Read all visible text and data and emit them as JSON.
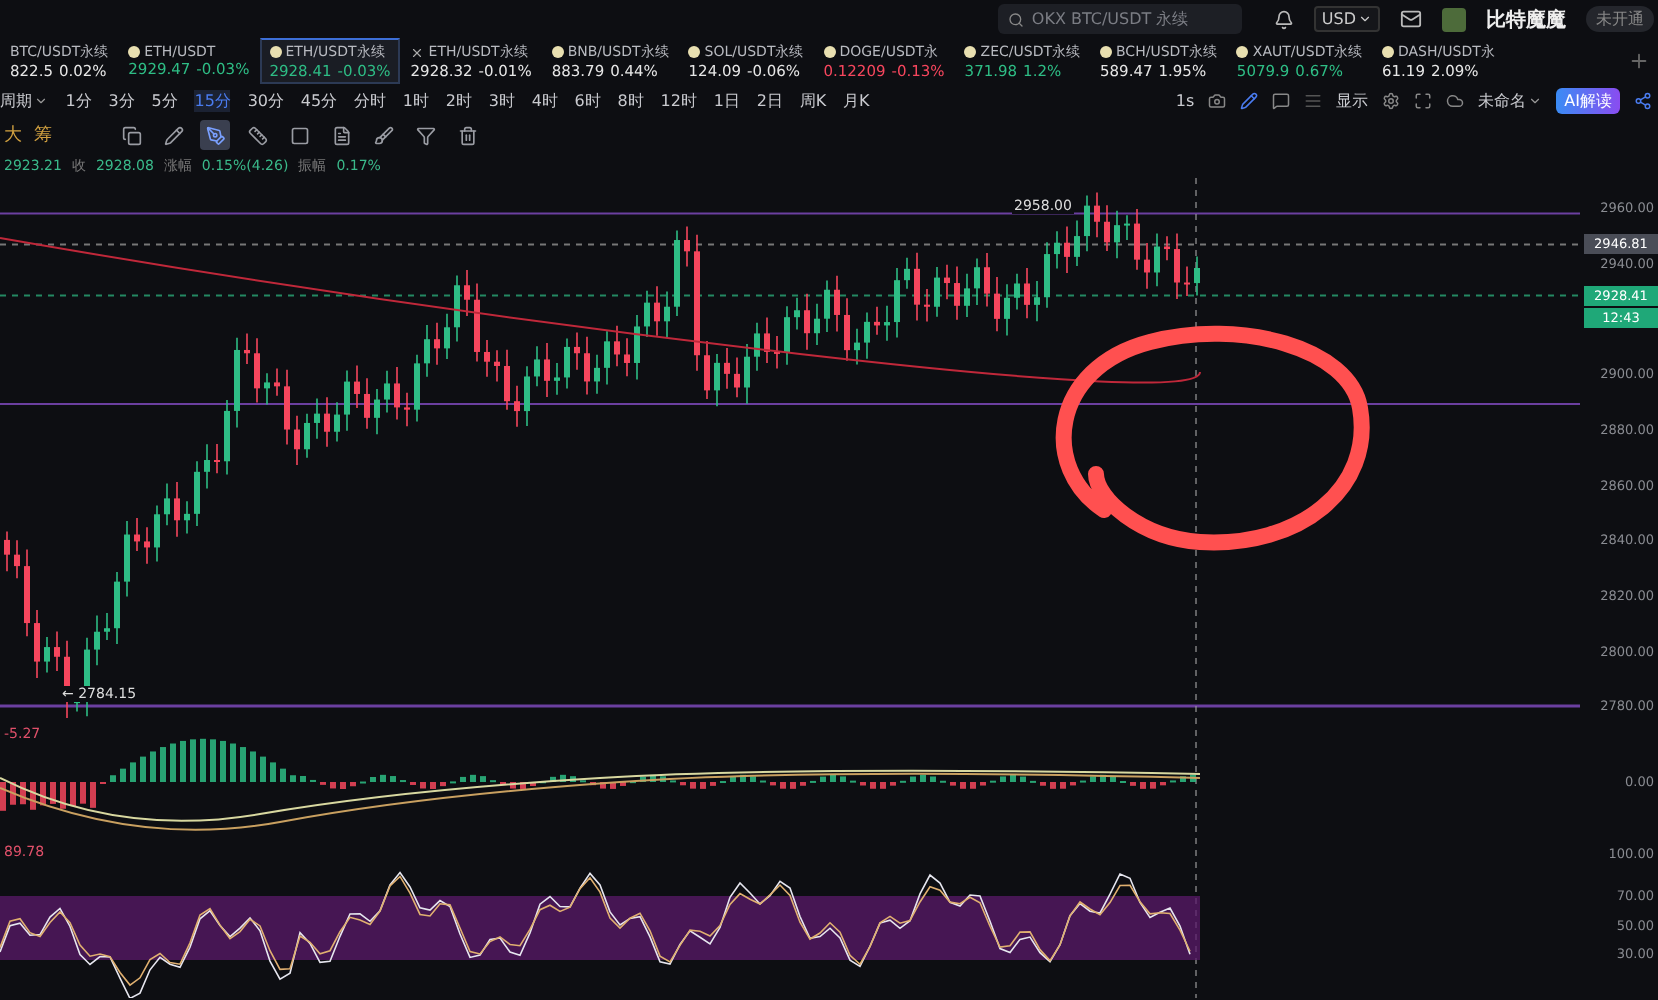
{
  "top_bar": {
    "search": {
      "placeholder": "OKX BTC/USDT 永续"
    },
    "currency": "USD",
    "user": {
      "name": "比特魔魔",
      "badge": "未开通"
    }
  },
  "tickers": [
    {
      "name": "BTC/USDT永续",
      "price": "822.5",
      "change": "0.02%",
      "color": "#e6e6e6",
      "selected": false,
      "closable": false,
      "coin": false
    },
    {
      "name": "ETH/USDT",
      "price": "2929.47",
      "change": "-0.03%",
      "color": "#2ebd85",
      "selected": false,
      "closable": false,
      "coin": true
    },
    {
      "name": "ETH/USDT永续",
      "price": "2928.41",
      "change": "-0.03%",
      "color": "#2ebd85",
      "selected": true,
      "closable": false,
      "coin": true
    },
    {
      "name": "ETH/USDT永续",
      "price": "2928.32",
      "change": "-0.01%",
      "color": "#e6e6e6",
      "selected": false,
      "closable": true,
      "coin": false
    },
    {
      "name": "BNB/USDT永续",
      "price": "883.79",
      "change": "0.44%",
      "color": "#e6e6e6",
      "selected": false,
      "closable": false,
      "coin": true
    },
    {
      "name": "SOL/USDT永续",
      "price": "124.09",
      "change": "-0.06%",
      "color": "#e6e6e6",
      "selected": false,
      "closable": false,
      "coin": true
    },
    {
      "name": "DOGE/USDT永",
      "price": "0.12209",
      "change": "-0.13%",
      "color": "#f6465d",
      "selected": false,
      "closable": false,
      "coin": true
    },
    {
      "name": "ZEC/USDT永续",
      "price": "371.98",
      "change": "1.2%",
      "color": "#2ebd85",
      "selected": false,
      "closable": false,
      "coin": true
    },
    {
      "name": "BCH/USDT永续",
      "price": "589.47",
      "change": "1.95%",
      "color": "#e6e6e6",
      "selected": false,
      "closable": false,
      "coin": true
    },
    {
      "name": "XAUT/USDT永续",
      "price": "5079.9",
      "change": "0.67%",
      "color": "#2ebd85",
      "selected": false,
      "closable": false,
      "coin": true
    },
    {
      "name": "DASH/USDT永",
      "price": "61.19",
      "change": "2.09%",
      "color": "#e6e6e6",
      "selected": false,
      "closable": false,
      "coin": true
    }
  ],
  "periods": {
    "label": "周期",
    "items": [
      {
        "label": "1分",
        "selected": false
      },
      {
        "label": "3分",
        "selected": false
      },
      {
        "label": "5分",
        "selected": false
      },
      {
        "label": "15分",
        "selected": true
      },
      {
        "label": "30分",
        "selected": false
      },
      {
        "label": "45分",
        "selected": false
      },
      {
        "label": "分时",
        "selected": false
      },
      {
        "label": "1时",
        "selected": false
      },
      {
        "label": "2时",
        "selected": false
      },
      {
        "label": "3时",
        "selected": false
      },
      {
        "label": "4时",
        "selected": false
      },
      {
        "label": "6时",
        "selected": false
      },
      {
        "label": "8时",
        "selected": false
      },
      {
        "label": "12时",
        "selected": false
      },
      {
        "label": "1日",
        "selected": false
      },
      {
        "label": "2日",
        "selected": false
      },
      {
        "label": "周K",
        "selected": false
      },
      {
        "label": "月K",
        "selected": false
      }
    ]
  },
  "chart_tools": {
    "interval": "1s",
    "display": "显示",
    "layout_name": "未命名",
    "ai_button": "AI解读"
  },
  "drawing_tools": {
    "labels": [
      "大",
      "筹"
    ],
    "tools": [
      {
        "kind": "copy",
        "selected": false
      },
      {
        "kind": "pencil",
        "selected": false
      },
      {
        "kind": "pen",
        "selected": true
      },
      {
        "kind": "ruler",
        "selected": false
      },
      {
        "kind": "square",
        "selected": false
      },
      {
        "kind": "note",
        "selected": false
      },
      {
        "kind": "brush",
        "selected": false
      },
      {
        "kind": "filter",
        "selected": false
      },
      {
        "kind": "trash",
        "selected": false
      }
    ]
  },
  "ohlc_line": {
    "first": "2923.21",
    "pairs": [
      {
        "label": "收",
        "value": "2928.08"
      },
      {
        "label": "涨幅",
        "value": "0.15%(4.26)"
      },
      {
        "label": "振幅",
        "value": "0.17%"
      }
    ]
  },
  "main_chart": {
    "high_label": "2958.00",
    "low_label": "← 2784.15"
  },
  "price_axis": {
    "ticks": [
      "2960.00",
      "2940.00",
      "2900.00",
      "2880.00",
      "2860.00",
      "2840.00",
      "2820.00",
      "2800.00",
      "2780.00"
    ],
    "crosshair_tag": "2946.81",
    "last_price_tag": "2928.41",
    "countdown_tag": "12:43"
  },
  "macd": {
    "reading": "-5.27",
    "axis": [
      "0.00"
    ]
  },
  "rsi": {
    "reading": "89.78",
    "axis": [
      "100.00",
      "70.00",
      "50.00",
      "30.00"
    ]
  }
}
